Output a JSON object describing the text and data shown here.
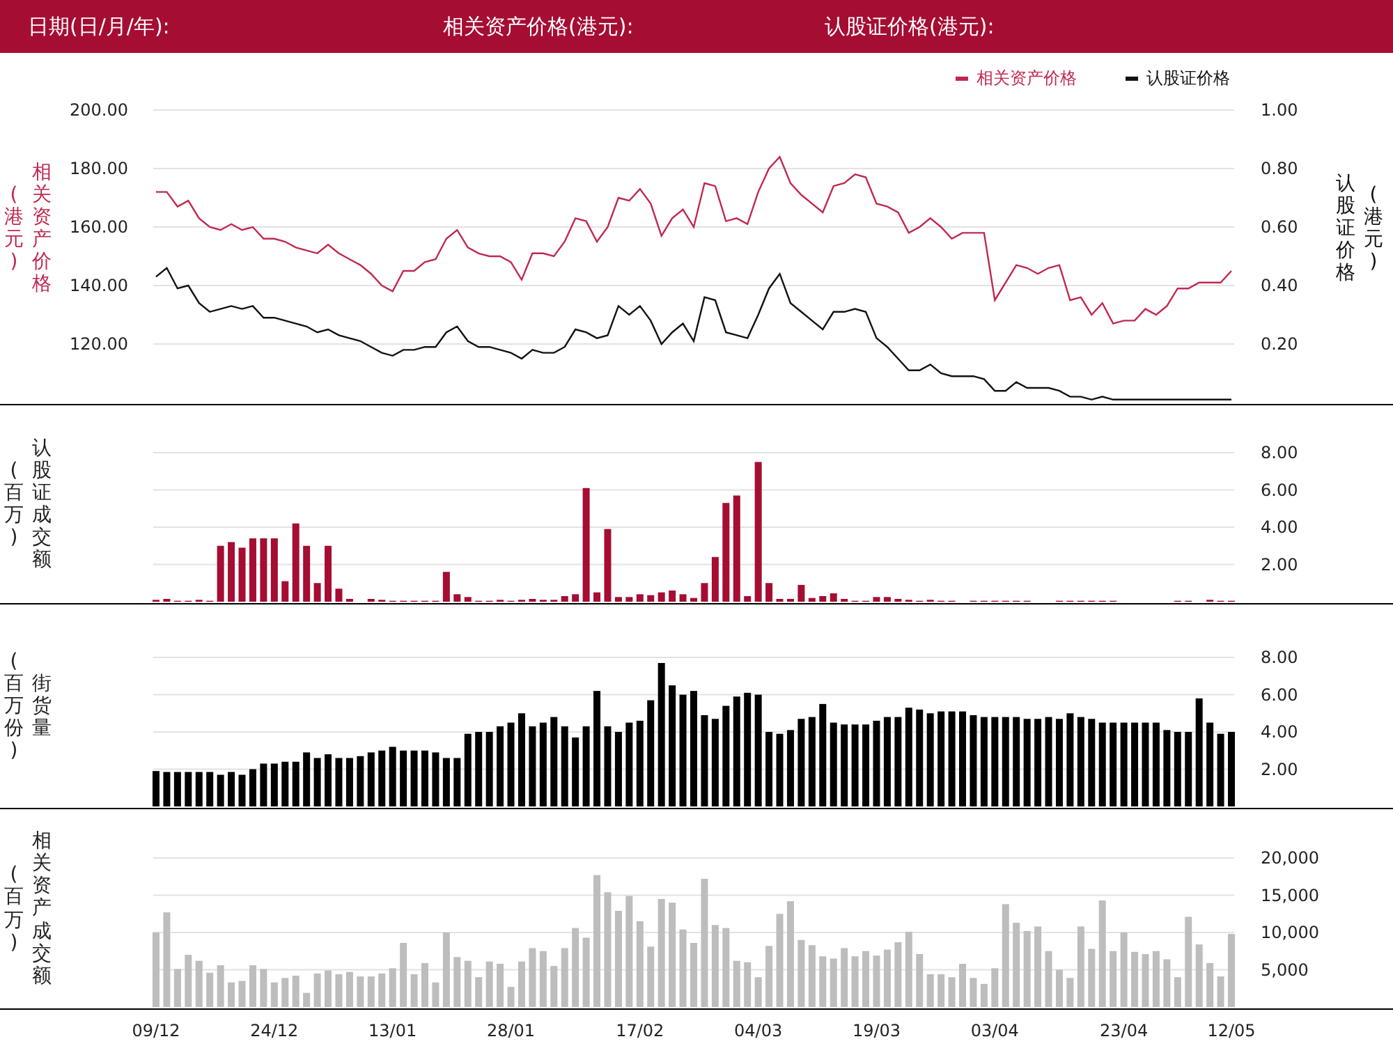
{
  "header": {
    "fields": [
      "日期(日/月/年):",
      "相关资产价格(港元):",
      "认股证价格(港元):"
    ]
  },
  "charts": [
    {
      "axis_left": {
        "title": "相关资产价格",
        "unit": "(港元)"
      },
      "axis_right": {
        "title": "认股证价格",
        "unit": "(港元)"
      },
      "chart_data": {
        "type": "line",
        "ylim": [
          100,
          200
        ],
        "y2lim": [
          0,
          1
        ],
        "grid": true,
        "legend": true,
        "yticks": [
          {
            "value": 120,
            "label": "120.00"
          },
          {
            "value": 140,
            "label": "140.00"
          },
          {
            "value": 160,
            "label": "160.00"
          },
          {
            "value": 180,
            "label": "180.00"
          },
          {
            "value": 200,
            "label": "200.00"
          }
        ],
        "y2ticks": [
          {
            "value": 0.2,
            "label": "0.20"
          },
          {
            "value": 0.4,
            "label": "0.40"
          },
          {
            "value": 0.6,
            "label": "0.60"
          },
          {
            "value": 0.8,
            "label": "0.80"
          },
          {
            "value": 1,
            "label": "1.00"
          }
        ],
        "series": [
          {
            "name": "相关资产价格",
            "color": "#c0284f",
            "values": [
              172,
              172,
              167,
              169,
              163,
              160,
              159,
              161,
              159,
              160,
              156,
              156,
              155,
              153,
              152,
              151,
              154,
              151,
              149,
              147,
              144,
              140,
              138,
              145,
              145,
              148,
              149,
              156,
              159,
              153,
              151,
              150,
              150,
              148,
              142,
              151,
              151,
              150,
              155,
              163,
              162,
              155,
              160,
              170,
              169,
              173,
              168,
              157,
              163,
              166,
              160,
              175,
              174,
              162,
              163,
              161,
              172,
              180,
              184,
              175,
              171,
              168,
              165,
              174,
              175,
              178,
              177,
              168,
              167,
              165,
              158,
              160,
              163,
              160,
              156,
              158,
              158,
              158,
              135,
              141,
              147,
              146,
              144,
              146,
              147,
              135,
              136,
              130,
              134,
              127,
              128,
              128,
              132,
              130,
              133,
              139,
              139,
              141,
              141,
              141,
              145
            ]
          },
          {
            "name": "认股证价格",
            "color": "#111111",
            "axis": "y2",
            "values": [
              0.43,
              0.46,
              0.39,
              0.4,
              0.34,
              0.31,
              0.32,
              0.33,
              0.32,
              0.33,
              0.29,
              0.29,
              0.28,
              0.27,
              0.26,
              0.24,
              0.25,
              0.23,
              0.22,
              0.21,
              0.19,
              0.17,
              0.16,
              0.18,
              0.18,
              0.19,
              0.19,
              0.24,
              0.26,
              0.21,
              0.19,
              0.19,
              0.18,
              0.17,
              0.15,
              0.18,
              0.17,
              0.17,
              0.19,
              0.25,
              0.24,
              0.22,
              0.23,
              0.33,
              0.3,
              0.33,
              0.28,
              0.2,
              0.24,
              0.27,
              0.21,
              0.36,
              0.35,
              0.24,
              0.23,
              0.22,
              0.3,
              0.39,
              0.44,
              0.34,
              0.31,
              0.28,
              0.25,
              0.31,
              0.31,
              0.32,
              0.31,
              0.22,
              0.19,
              0.15,
              0.11,
              0.11,
              0.13,
              0.1,
              0.09,
              0.09,
              0.09,
              0.08,
              0.04,
              0.04,
              0.07,
              0.05,
              0.05,
              0.05,
              0.04,
              0.02,
              0.02,
              0.01,
              0.02,
              0.01,
              0.01,
              0.01,
              0.01,
              0.01,
              0.01,
              0.01,
              0.01,
              0.01,
              0.01,
              0.01,
              0.01
            ]
          }
        ]
      }
    },
    {
      "axis_left": {
        "title": "认股证成交额",
        "unit": "(百万)"
      },
      "chart_data": {
        "type": "bar",
        "ylim": [
          0,
          8
        ],
        "grid": true,
        "yticks": [
          {
            "value": 2,
            "label": "2.00"
          },
          {
            "value": 4,
            "label": "4.00"
          },
          {
            "value": 6,
            "label": "6.00"
          },
          {
            "value": 8,
            "label": "8.00"
          }
        ],
        "series": [
          {
            "color": "#a50d33",
            "values": [
              0.1,
              0.15,
              0.05,
              0.05,
              0.1,
              0.05,
              3.0,
              3.2,
              2.9,
              3.4,
              3.4,
              3.4,
              1.1,
              4.2,
              3.0,
              1.0,
              3.0,
              0.7,
              0.15,
              0,
              0.15,
              0.1,
              0.05,
              0.05,
              0.05,
              0.05,
              0.05,
              1.6,
              0.4,
              0.25,
              0.05,
              0.05,
              0.1,
              0.05,
              0.1,
              0.15,
              0.1,
              0.1,
              0.3,
              0.4,
              6.1,
              0.5,
              3.9,
              0.25,
              0.25,
              0.4,
              0.35,
              0.5,
              0.6,
              0.4,
              0.2,
              1.0,
              2.4,
              5.3,
              5.7,
              0.3,
              7.5,
              1.0,
              0.15,
              0.15,
              0.9,
              0.2,
              0.3,
              0.45,
              0.15,
              0.05,
              0.05,
              0.25,
              0.25,
              0.15,
              0.1,
              0.05,
              0.1,
              0.05,
              0.05,
              0,
              0.05,
              0.05,
              0.05,
              0.05,
              0.05,
              0.05,
              0,
              0,
              0.05,
              0.05,
              0.05,
              0.05,
              0.05,
              0.05,
              0,
              0,
              0,
              0,
              0,
              0.05,
              0.05,
              0,
              0.1,
              0.05,
              0.05
            ]
          }
        ]
      }
    },
    {
      "axis_left": {
        "title": "街货量",
        "unit": "(百万份)"
      },
      "chart_data": {
        "type": "bar",
        "ylim": [
          0,
          8
        ],
        "grid": true,
        "yticks": [
          {
            "value": 2,
            "label": "2.00"
          },
          {
            "value": 4,
            "label": "4.00"
          },
          {
            "value": 6,
            "label": "6.00"
          },
          {
            "value": 8,
            "label": "8.00"
          }
        ],
        "series": [
          {
            "color": "#000000",
            "values": [
              1.9,
              1.85,
              1.85,
              1.85,
              1.85,
              1.85,
              1.7,
              1.85,
              1.7,
              2.0,
              2.3,
              2.3,
              2.4,
              2.4,
              2.9,
              2.6,
              2.8,
              2.6,
              2.6,
              2.7,
              2.9,
              3.0,
              3.2,
              3.0,
              3.0,
              3.0,
              2.9,
              2.6,
              2.6,
              3.9,
              4.0,
              4.0,
              4.3,
              4.5,
              5.0,
              4.3,
              4.5,
              4.8,
              4.3,
              3.7,
              4.3,
              6.2,
              4.3,
              4.0,
              4.5,
              4.6,
              5.7,
              7.7,
              6.5,
              6.0,
              6.2,
              4.9,
              4.7,
              5.4,
              5.9,
              6.1,
              6.0,
              4.0,
              3.9,
              4.1,
              4.7,
              4.8,
              5.5,
              4.5,
              4.4,
              4.4,
              4.4,
              4.6,
              4.8,
              4.8,
              5.3,
              5.2,
              5.0,
              5.1,
              5.1,
              5.1,
              4.9,
              4.8,
              4.8,
              4.8,
              4.8,
              4.7,
              4.7,
              4.8,
              4.7,
              5.0,
              4.8,
              4.7,
              4.5,
              4.5,
              4.5,
              4.5,
              4.5,
              4.5,
              4.1,
              4.0,
              4.0,
              5.8,
              4.5,
              3.9,
              4.0
            ]
          }
        ]
      }
    },
    {
      "axis_left": {
        "title": "相关资产成交额",
        "unit": "(百万)"
      },
      "chart_data": {
        "type": "bar",
        "ylim": [
          0,
          20000
        ],
        "grid": true,
        "categories": [
          "09/12",
          null,
          null,
          null,
          null,
          null,
          null,
          null,
          null,
          null,
          null,
          "24/12",
          null,
          null,
          null,
          null,
          null,
          null,
          null,
          null,
          null,
          null,
          "13/01",
          null,
          null,
          null,
          null,
          null,
          null,
          null,
          null,
          null,
          null,
          "28/01",
          null,
          null,
          null,
          null,
          null,
          null,
          null,
          null,
          null,
          null,
          null,
          "17/02",
          null,
          null,
          null,
          null,
          null,
          null,
          null,
          null,
          null,
          null,
          "04/03",
          null,
          null,
          null,
          null,
          null,
          null,
          null,
          null,
          null,
          null,
          "19/03",
          null,
          null,
          null,
          null,
          null,
          null,
          null,
          null,
          null,
          null,
          "03/04",
          null,
          null,
          null,
          null,
          null,
          null,
          null,
          null,
          null,
          null,
          null,
          "23/04",
          null,
          null,
          null,
          null,
          null,
          null,
          null,
          null,
          null,
          "12/05"
        ],
        "yticks": [
          {
            "value": 5000,
            "label": "5,000"
          },
          {
            "value": 10000,
            "label": "10,000"
          },
          {
            "value": 15000,
            "label": "15,000"
          },
          {
            "value": 20000,
            "label": "20,000"
          }
        ],
        "series": [
          {
            "color": "#bdbdbd",
            "values": [
              10000,
              12700,
              5100,
              7000,
              6200,
              4600,
              5600,
              3300,
              3500,
              5600,
              5100,
              3300,
              3900,
              4200,
              1900,
              4500,
              4900,
              4400,
              4700,
              4100,
              4100,
              4500,
              5200,
              8600,
              4400,
              5900,
              3300,
              10000,
              6700,
              6200,
              4000,
              6100,
              5800,
              2700,
              6100,
              7900,
              7500,
              5500,
              7900,
              10600,
              9300,
              17700,
              15400,
              12900,
              14900,
              11500,
              8100,
              14500,
              14000,
              10400,
              8600,
              17200,
              11000,
              10600,
              6200,
              6000,
              4000,
              8200,
              12500,
              14200,
              9000,
              8300,
              6800,
              6500,
              7900,
              6800,
              7500,
              6900,
              7700,
              8700,
              10100,
              7100,
              4400,
              4400,
              4000,
              5800,
              3900,
              3100,
              5200,
              13800,
              11300,
              10200,
              10800,
              7500,
              5000,
              3900,
              10800,
              7800,
              14300,
              7500,
              10000,
              7400,
              7100,
              7500,
              6400,
              4000,
              12100,
              8400,
              5900,
              4100,
              9800
            ]
          }
        ]
      }
    }
  ]
}
